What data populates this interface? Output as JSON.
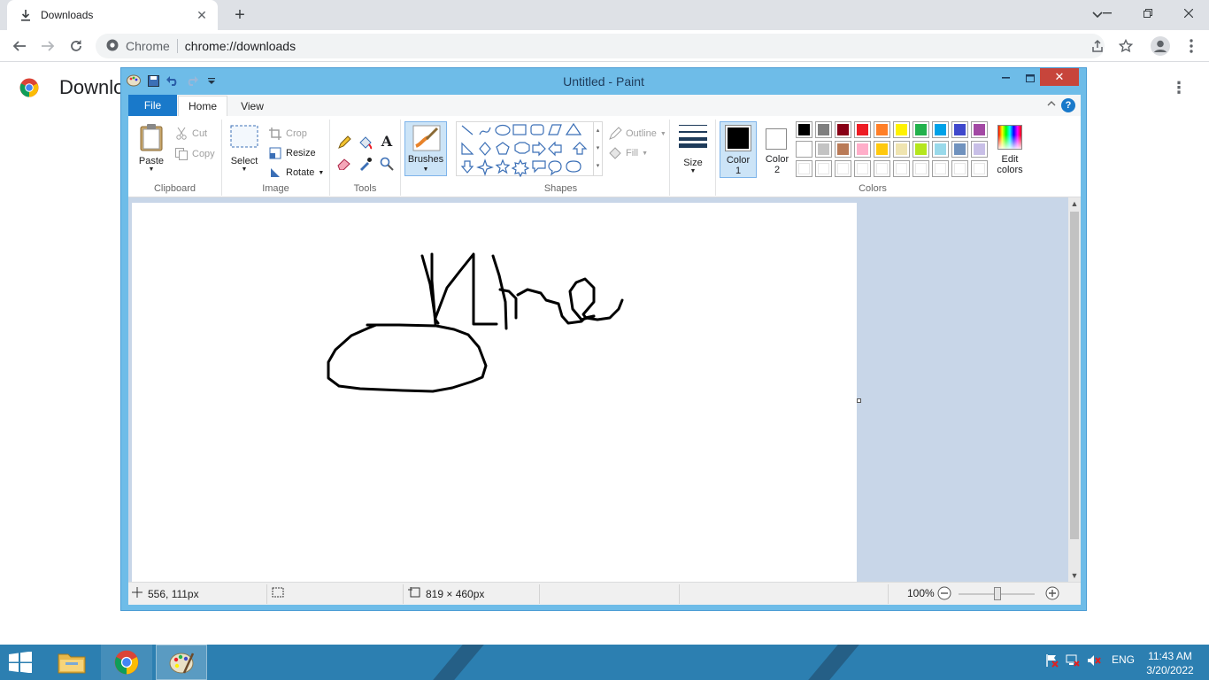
{
  "browser": {
    "tab_title": "Downloads",
    "address_site": "Chrome",
    "address_url": "chrome://downloads",
    "page_title": "Downloads"
  },
  "paint": {
    "window_title": "Untitled - Paint",
    "tabs": {
      "file": "File",
      "home": "Home",
      "view": "View"
    },
    "clipboard": {
      "paste": "Paste",
      "cut": "Cut",
      "copy": "Copy",
      "label": "Clipboard"
    },
    "image": {
      "select": "Select",
      "crop": "Crop",
      "resize": "Resize",
      "rotate": "Rotate",
      "label": "Image"
    },
    "tools": {
      "label": "Tools"
    },
    "brushes": {
      "label": "Brushes"
    },
    "shapes": {
      "outline": "Outline",
      "fill": "Fill",
      "label": "Shapes"
    },
    "size": {
      "label": "Size"
    },
    "colors": {
      "color1_line1": "Color",
      "color1_line2": "1",
      "color2_line1": "Color",
      "color2_line2": "2",
      "edit_line1": "Edit",
      "edit_line2": "colors",
      "label": "Colors",
      "color1": "#000000",
      "color2": "#ffffff",
      "row1": [
        "#000000",
        "#7f7f7f",
        "#880015",
        "#ed1c24",
        "#ff7f27",
        "#fff200",
        "#22b14c",
        "#00a2e8",
        "#3f48cc",
        "#a349a4"
      ],
      "row2": [
        "#ffffff",
        "#c3c3c3",
        "#b97a57",
        "#ffaec9",
        "#ffc90e",
        "#efe4b0",
        "#b5e61d",
        "#99d9ea",
        "#7092be",
        "#c8bfe7"
      ],
      "row3": [
        "#ffffff",
        "#ffffff",
        "#ffffff",
        "#ffffff",
        "#ffffff",
        "#ffffff",
        "#ffffff",
        "#ffffff",
        "#ffffff",
        "#ffffff"
      ]
    },
    "status": {
      "cursor_pos": "556, 111px",
      "canvas_size": "819 × 460px",
      "zoom": "100%"
    }
  },
  "taskbar": {
    "language": "ENG",
    "time": "11:43 AM",
    "date": "3/20/2022"
  }
}
